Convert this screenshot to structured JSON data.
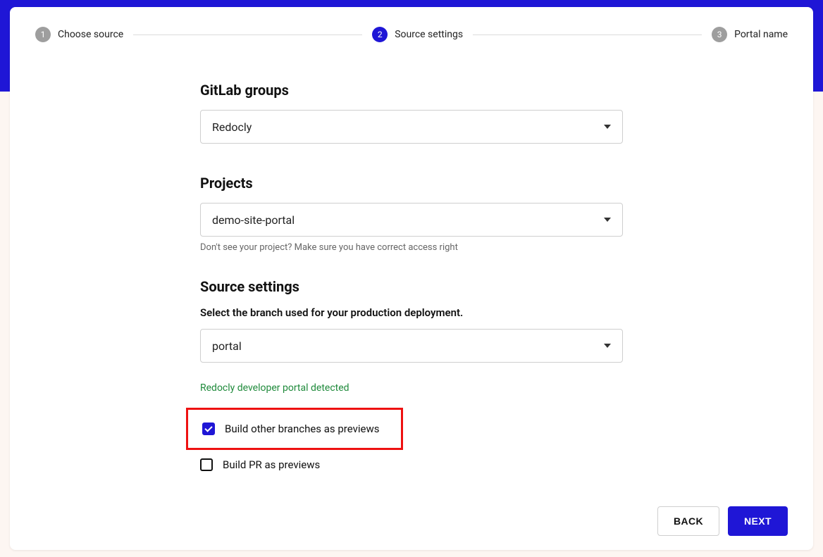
{
  "stepper": {
    "steps": [
      {
        "num": "1",
        "label": "Choose source",
        "active": false
      },
      {
        "num": "2",
        "label": "Source settings",
        "active": true
      },
      {
        "num": "3",
        "label": "Portal name",
        "active": false
      }
    ]
  },
  "sections": {
    "groups": {
      "title": "GitLab groups",
      "value": "Redocly"
    },
    "projects": {
      "title": "Projects",
      "value": "demo-site-portal",
      "helper": "Don't see your project? Make sure you have correct access right"
    },
    "source": {
      "title": "Source settings",
      "branch_label": "Select the branch used for your production deployment.",
      "branch_value": "portal"
    },
    "detected": "Redocly developer portal detected",
    "checks": {
      "other_branches": "Build other branches as previews",
      "pr_previews": "Build PR as previews"
    }
  },
  "footer": {
    "back": "BACK",
    "next": "NEXT"
  }
}
